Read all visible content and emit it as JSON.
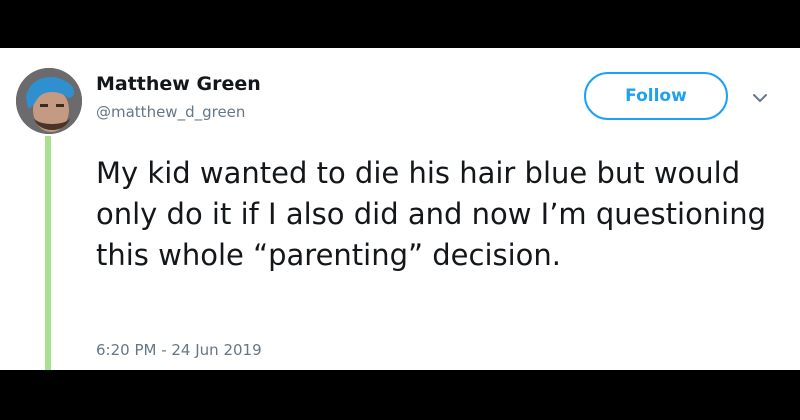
{
  "tweet": {
    "author_name": "Matthew Green",
    "author_handle": "@matthew_d_green",
    "follow_label": "Follow",
    "text": "My kid wanted to die his hair blue but would only do it if I also did and now I’m questioning this whole “parenting” decision.",
    "timestamp": "6:20 PM - 24 Jun 2019"
  },
  "colors": {
    "accent": "#1da1f2",
    "thread_line": "#a9df8f",
    "text": "#14171a",
    "muted": "#657786"
  },
  "icons": {
    "avatar": "avatar",
    "caret": "chevron-down-icon"
  }
}
